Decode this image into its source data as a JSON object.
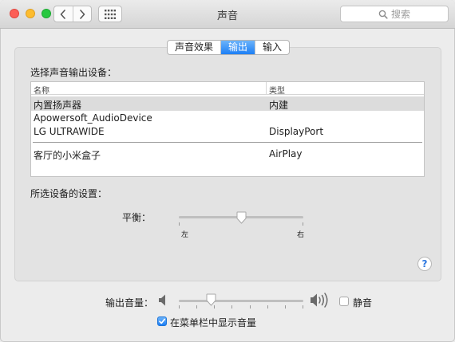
{
  "window": {
    "title": "声音"
  },
  "search": {
    "placeholder": "搜索"
  },
  "tabs": [
    {
      "label": "声音效果",
      "active": false
    },
    {
      "label": "输出",
      "active": true
    },
    {
      "label": "输入",
      "active": false
    }
  ],
  "output": {
    "select_label": "选择声音输出设备：",
    "columns": {
      "name": "名称",
      "type": "类型"
    },
    "devices": [
      {
        "name": "内置扬声器",
        "type": "内建",
        "selected": true
      },
      {
        "name": "Apowersoft_AudioDevice",
        "type": "",
        "selected": false
      },
      {
        "name": "LG ULTRAWIDE",
        "type": "DisplayPort",
        "selected": false
      },
      {
        "name": "客厅的小米盒子",
        "type": "AirPlay",
        "selected": false
      }
    ],
    "settings_label": "所选设备的设置：",
    "balance": {
      "label": "平衡：",
      "left": "左",
      "right": "右",
      "value": 0.5
    }
  },
  "volume": {
    "label": "输出音量：",
    "value": 0.26,
    "mute_label": "静音",
    "mute_checked": false
  },
  "menubar_option": {
    "label": "在菜单栏中显示音量",
    "checked": true
  },
  "help": {
    "symbol": "?"
  },
  "colors": {
    "accent": "#1d7ff5",
    "selected_row": "#dcdcdc"
  },
  "icons": [
    "close-button",
    "minimize-button",
    "zoom-button",
    "back-icon",
    "forward-icon",
    "grid-icon",
    "search-icon",
    "speaker-low-icon",
    "speaker-high-icon",
    "help-icon",
    "checkmark-icon"
  ]
}
